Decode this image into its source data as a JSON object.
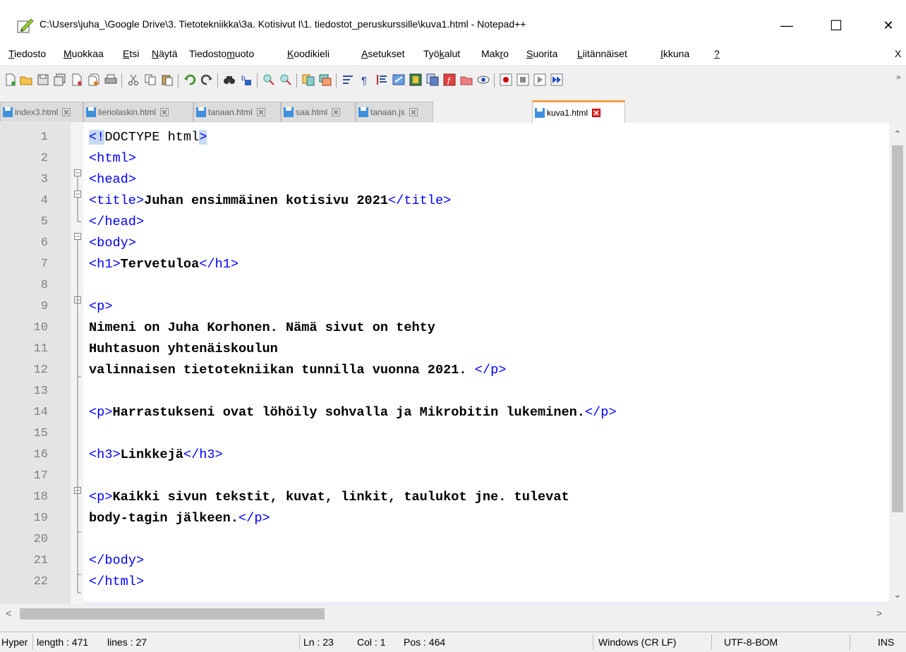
{
  "window": {
    "title": "C:\\Users\\juha_\\Google Drive\\3. Tietotekniikka\\3a. Kotisivut I\\1. tiedostot_peruskurssille\\kuva1.html - Notepad++",
    "minimize": "—",
    "maximize": "☐",
    "close": "✕"
  },
  "menu": {
    "items": [
      {
        "acc": "T",
        "rest": "iedosto"
      },
      {
        "acc": "M",
        "rest": "uokkaa"
      },
      {
        "acc": "E",
        "rest": "tsi"
      },
      {
        "acc": "N",
        "rest": "äytä"
      },
      {
        "pre": "Tiedosto",
        "acc": "m",
        "rest": "uoto"
      },
      {
        "acc": "K",
        "rest": "oodikieli"
      },
      {
        "acc": "A",
        "rest": "setukset"
      },
      {
        "pre": "Työ",
        "acc": "k",
        "rest": "alut"
      },
      {
        "pre": "Mak",
        "acc": "r",
        "rest": "o"
      },
      {
        "acc": "S",
        "rest": "uorita"
      },
      {
        "acc": "L",
        "rest": "iitännäiset"
      },
      {
        "acc": "I",
        "rest": "kkuna"
      },
      {
        "acc": "?",
        "rest": ""
      }
    ],
    "close_doc": "X"
  },
  "tabs": [
    {
      "label": "index3.html"
    },
    {
      "label": "lieriolaskin.html"
    },
    {
      "label": "tanaan.html"
    },
    {
      "label": "saa.html"
    },
    {
      "label": "tanaan.js"
    },
    {
      "label": "kuva1.html"
    }
  ],
  "editor": {
    "line_numbers": [
      "1",
      "2",
      "3",
      "4",
      "5",
      "6",
      "7",
      "8",
      "9",
      "10",
      "11",
      "12",
      "13",
      "14",
      "15",
      "16",
      "17",
      "18",
      "19",
      "20",
      "21",
      "22"
    ],
    "lines": {
      "l1a": "<!",
      "l1b": "DOCTYPE html",
      "l1c": ">",
      "l2": "<html>",
      "l3": "<head>",
      "l4a": "<title>",
      "l4b": "Juhan ensimmäinen kotisivu 2021",
      "l4c": "</title>",
      "l5": "</head>",
      "l6": "<body>",
      "l7a": "<h1>",
      "l7b": "Tervetuloa",
      "l7c": "</h1>",
      "l9": "<p>",
      "l10": "Nimeni on Juha Korhonen. Nämä sivut on tehty",
      "l11": "Huhtasuon yhtenäiskoulun",
      "l12a": "valinnaisen tietotekniikan tunnilla vuonna 2021. ",
      "l12b": "</p>",
      "l14a": "<p>",
      "l14b": "Harrastukseni ovat löhöily sohvalla ja Mikrobitin lukeminen.",
      "l14c": "</p>",
      "l16a": "<h3>",
      "l16b": "Linkkejä",
      "l16c": "</h3>",
      "l18a": "<p>",
      "l18b": "Kaikki sivun tekstit, kuvat, linkit, taulukot jne. tulevat",
      "l19a": "body-tagin jälkeen.",
      "l19b": "</p>",
      "l21": "</body>",
      "l22": "</html>"
    }
  },
  "status": {
    "type": "Hyper",
    "length": "length : 471",
    "lines": "lines : 27",
    "ln": "Ln : 23",
    "col": "Col : 1",
    "pos": "Pos : 464",
    "eol": "Windows (CR LF)",
    "encoding": "UTF-8-BOM",
    "mode": "INS"
  }
}
